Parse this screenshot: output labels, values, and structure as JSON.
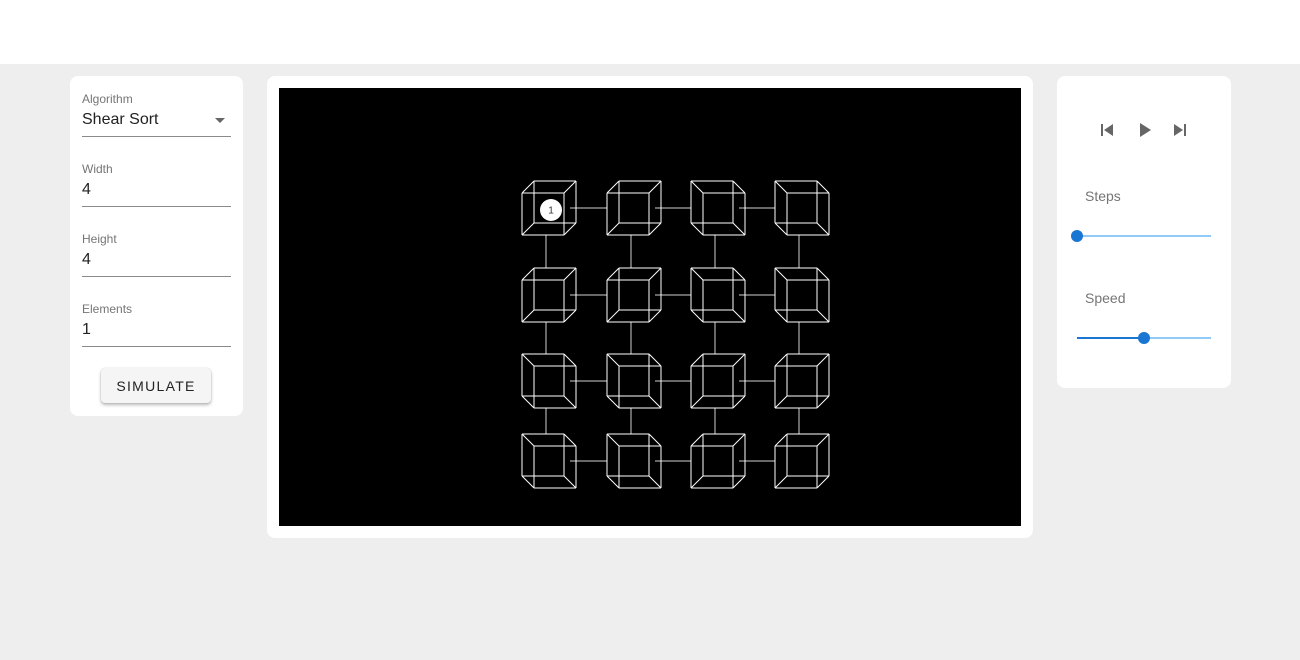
{
  "settings": {
    "algorithm_label": "Algorithm",
    "algorithm_value": "Shear Sort",
    "width_label": "Width",
    "width_value": "4",
    "height_label": "Height",
    "height_value": "4",
    "elements_label": "Elements",
    "elements_value": "1",
    "simulate_label": "SIMULATE"
  },
  "grid": {
    "rows": 4,
    "cols": 4,
    "element": {
      "row": 0,
      "col": 0,
      "label": "1"
    }
  },
  "playback": {
    "prev_icon": "skip-previous-icon",
    "play_icon": "play-icon",
    "next_icon": "skip-next-icon",
    "steps_label": "Steps",
    "steps_fraction": 0,
    "speed_label": "Speed",
    "speed_fraction": 0.5
  },
  "colors": {
    "accent": "#1976d2",
    "accent_light": "#90caf9",
    "canvas_bg": "#000000",
    "wire": "#ffffff"
  }
}
